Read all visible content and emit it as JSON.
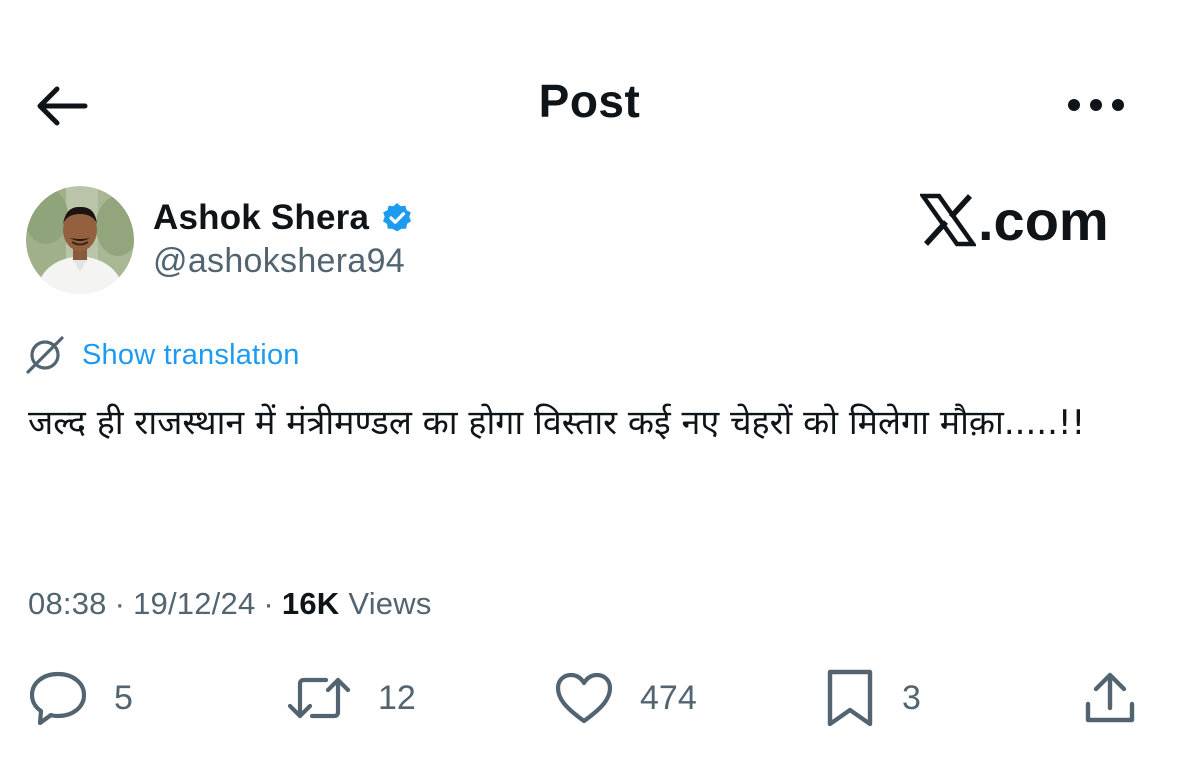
{
  "header": {
    "title": "Post",
    "back_icon": "arrow-left-icon",
    "more_icon": "more-horizontal-icon"
  },
  "author": {
    "name": "Ashok Shera",
    "handle": "@ashokshera94",
    "verified": true,
    "verified_color": "#1d9bf0"
  },
  "watermark": {
    "logo": "X",
    "text": ".com"
  },
  "translation": {
    "label": "Show translation",
    "icon": "globe-icon",
    "color": "#1d9bf0"
  },
  "post": {
    "text": "जल्द ही राजस्थान में मंत्रीमण्डल का होगा विस्तार कई नए चेहरों को मिलेगा मौक़ा.....!!"
  },
  "meta": {
    "time": "08:38",
    "separator": "·",
    "date": "19/12/24",
    "views_count": "16K",
    "views_label": "Views"
  },
  "actions": {
    "replies": "5",
    "reposts": "12",
    "likes": "474",
    "bookmarks": "3"
  },
  "colors": {
    "text": "#0f1419",
    "secondary": "#536471",
    "accent": "#1d9bf0"
  }
}
